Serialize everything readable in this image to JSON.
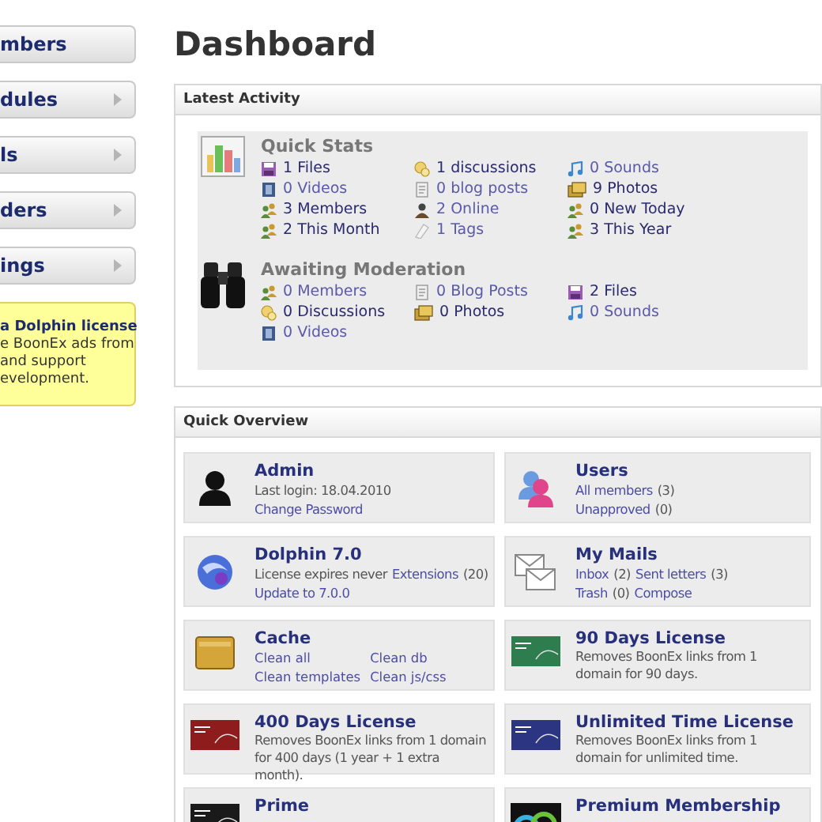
{
  "sidebar": {
    "items": [
      {
        "label": "mbers",
        "expanded": true
      },
      {
        "label": "dules",
        "expanded": false
      },
      {
        "label": "ls",
        "expanded": false
      },
      {
        "label": "ders",
        "expanded": false
      },
      {
        "label": "ings",
        "expanded": false
      }
    ],
    "notice": [
      "**a Dolphin license**",
      "e BoonEx ads from",
      "and support",
      "evelopment."
    ]
  },
  "page_title": "Dashboard",
  "latest_activity": {
    "title": "Latest Activity",
    "panels": [
      {
        "title": "Quick Stats",
        "kind": "chart",
        "items": [
          {
            "text": "1 Files",
            "kind": "files",
            "highlight": true
          },
          {
            "text": "1 discussions",
            "kind": "discussions",
            "highlight": true
          },
          {
            "text": "0 Sounds",
            "kind": "sounds",
            "highlight": false
          },
          {
            "text": "0 Videos",
            "kind": "videos",
            "highlight": false
          },
          {
            "text": "0 blog posts",
            "kind": "blogs",
            "highlight": false
          },
          {
            "text": "9 Photos",
            "kind": "photos",
            "highlight": true
          },
          {
            "text": "3 Members",
            "kind": "members",
            "highlight": true
          },
          {
            "text": "2 Online",
            "kind": "online",
            "highlight": false
          },
          {
            "text": "0 New Today",
            "kind": "members",
            "highlight": true
          },
          {
            "text": "2 This Month",
            "kind": "members",
            "highlight": true
          },
          {
            "text": "1 Tags",
            "kind": "tags",
            "highlight": false
          },
          {
            "text": "3 This Year",
            "kind": "members",
            "highlight": true
          }
        ]
      },
      {
        "title": "Awaiting Moderation",
        "kind": "binoculars",
        "items": [
          {
            "text": "0 Members",
            "kind": "members",
            "highlight": false
          },
          {
            "text": "0 Blog Posts",
            "kind": "blogs",
            "highlight": false
          },
          {
            "text": "2 Files",
            "kind": "files",
            "highlight": true
          },
          {
            "text": "0 Discussions",
            "kind": "discussions",
            "highlight": true
          },
          {
            "text": "0 Photos",
            "kind": "photos",
            "highlight": true
          },
          {
            "text": "0 Sounds",
            "kind": "sounds",
            "highlight": false
          },
          {
            "text": "0 Videos",
            "kind": "videos",
            "highlight": false
          }
        ]
      }
    ]
  },
  "quick_overview": {
    "title": "Quick Overview",
    "cards": [
      {
        "kind": "user",
        "title": "Admin",
        "lines": [
          [
            {
              "text": "Last login: 18.04.2010",
              "link": false
            }
          ],
          [
            {
              "text": "Change Password",
              "link": true
            }
          ]
        ]
      },
      {
        "kind": "users",
        "title": "Users",
        "lines": [
          [
            {
              "text": "All members",
              "link": true
            },
            {
              "text": "(3)",
              "link": false
            }
          ],
          [
            {
              "text": "Unapproved",
              "link": true
            },
            {
              "text": "(0)",
              "link": false
            }
          ]
        ]
      },
      {
        "kind": "dolphin",
        "title": "Dolphin 7.0",
        "lines": [
          [
            {
              "text": "License expires never",
              "link": false
            },
            {
              "text": "Extensions",
              "link": true
            },
            {
              "text": "(20)",
              "link": false
            }
          ],
          [
            {
              "text": "Update to 7.0.0",
              "link": true
            }
          ]
        ]
      },
      {
        "kind": "mail",
        "title": "My Mails",
        "lines": [
          [
            {
              "text": "Inbox",
              "link": true
            },
            {
              "text": "(2)",
              "link": false
            },
            {
              "text": "Sent letters",
              "link": true
            },
            {
              "text": "(3)",
              "link": false
            }
          ],
          [
            {
              "text": "Trash",
              "link": true
            },
            {
              "text": "(0)",
              "link": false
            },
            {
              "text": "Compose",
              "link": true
            }
          ]
        ]
      },
      {
        "kind": "cache",
        "title": "Cache",
        "lines": [
          [
            {
              "text": "Clean all",
              "link": true
            },
            {
              "text": "Clean db",
              "link": true
            }
          ],
          [
            {
              "text": "Clean templates",
              "link": true
            },
            {
              "text": "Clean js/css",
              "link": true
            }
          ]
        ]
      },
      {
        "kind": "license",
        "color": "#2e7d4f",
        "title": "90 Days License",
        "description": "Removes BoonEx links from 1 domain for 90 days."
      },
      {
        "kind": "license",
        "color": "#8e1c1c",
        "title": "400 Days License",
        "description": "Removes BoonEx links from 1 domain for 400 days (1 year + 1 extra month)."
      },
      {
        "kind": "license",
        "color": "#2c3582",
        "title": "Unlimited Time License",
        "description": "Removes BoonEx links from 1 domain for unlimited time."
      },
      {
        "kind": "license",
        "color": "#1a1a1a",
        "title": "Prime"
      },
      {
        "kind": "premium",
        "title": "Premium Membership"
      }
    ]
  }
}
